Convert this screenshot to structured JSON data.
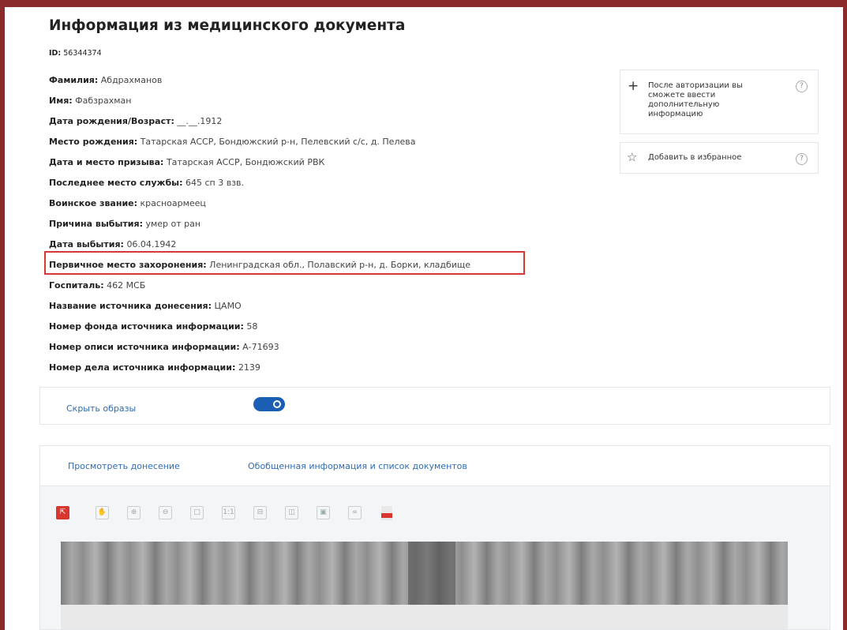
{
  "page": {
    "title": "Информация из медицинского документа",
    "id_label": "ID:",
    "id_value": "56344374"
  },
  "fields": [
    {
      "label": "Фамилия:",
      "value": "Абдрахманов"
    },
    {
      "label": "Имя:",
      "value": "Фабзрахман"
    },
    {
      "label": "Дата рождения/Возраст:",
      "value": "__.__.1912"
    },
    {
      "label": "Место рождения:",
      "value": "Татарская АССР, Бондюжский р-н, Пелевский с/с, д. Пелева"
    },
    {
      "label": "Дата и место призыва:",
      "value": "Татарская АССР, Бондюжский РВК"
    },
    {
      "label": "Последнее место службы:",
      "value": "645 сп 3 взв."
    },
    {
      "label": "Воинское звание:",
      "value": "красноармеец"
    },
    {
      "label": "Причина выбытия:",
      "value": "умер от ран"
    },
    {
      "label": "Дата выбытия:",
      "value": "06.04.1942"
    },
    {
      "label": "Первичное место захоронения:",
      "value": "Ленинградская обл., Полавский р-н, д. Борки, кладбище"
    },
    {
      "label": "Госпиталь:",
      "value": "462 МСБ"
    },
    {
      "label": "Название источника донесения:",
      "value": "ЦАМО"
    },
    {
      "label": "Номер фонда источника информации:",
      "value": "58"
    },
    {
      "label": "Номер описи источника информации:",
      "value": "А-71693"
    },
    {
      "label": "Номер дела источника информации:",
      "value": "2139"
    }
  ],
  "sidebar": {
    "auth_note": "После авторизации вы сможете ввести дополнительную информацию",
    "favorite_label": "Добавить в избранное",
    "help_glyph": "?"
  },
  "images_toggle": {
    "label": "Скрыть образы",
    "state": "on"
  },
  "viewer": {
    "tabs": [
      "Просмотреть донесение",
      "Обобщенная информация и список документов"
    ],
    "toolbar": [
      {
        "icon": "pointer-icon",
        "glyph": "⇱",
        "active": true
      },
      {
        "icon": "hand-icon",
        "glyph": "✋"
      },
      {
        "icon": "zoom-in-icon",
        "glyph": "⊕"
      },
      {
        "icon": "zoom-out-icon",
        "glyph": "⊖"
      },
      {
        "icon": "fit-page-icon",
        "glyph": "□"
      },
      {
        "icon": "actual-size-icon",
        "glyph": "1:1"
      },
      {
        "icon": "fit-width-icon",
        "glyph": "⊟"
      },
      {
        "icon": "fit-height-icon",
        "glyph": "◫"
      },
      {
        "icon": "save-icon",
        "glyph": "▣"
      },
      {
        "icon": "link-icon",
        "glyph": "∞"
      },
      {
        "icon": "pdf-icon",
        "glyph": ""
      }
    ]
  },
  "colors": {
    "frame": "#8a2a2a",
    "link": "#2f6bb3",
    "highlight_border": "#d63838",
    "toggle_on": "#1a5fb4",
    "tool_active": "#d9362f"
  }
}
